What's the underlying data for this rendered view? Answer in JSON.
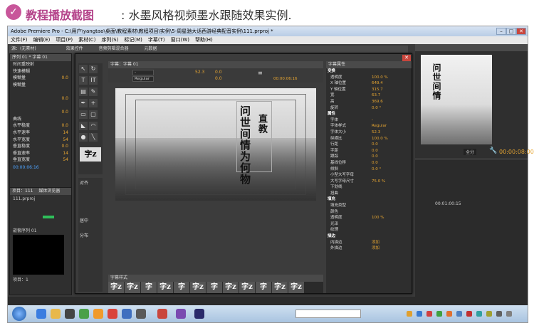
{
  "banner": {
    "icon": "chevron-down-icon",
    "title": "教程播放截图",
    "subtitle": ": 水墨风格视频墨水跟随效果实例."
  },
  "window": {
    "title": "Adobe Premiere Pro - C:\\用户\\yangtao\\桌面\\教程素材\\教程项目\\实例\\5-周星驰大话西游经典配音实例\\111.prproj *",
    "minimize": "–",
    "maximize": "□",
    "close": "✕"
  },
  "menu": [
    "文件(F)",
    "编辑(E)",
    "项目(P)",
    "素材(C)",
    "序列(S)",
    "标记(M)",
    "字幕(T)",
    "窗口(W)",
    "帮助(H)"
  ],
  "top_tabs": {
    "source": "源：(无素材)",
    "effect_controls": "效果控件",
    "audio_mixer": "音频剪辑混合器",
    "metadata": "元数据"
  },
  "left_panel": {
    "tab": "序列 01 * 字幕 01",
    "rows": [
      {
        "label": "时间重映射",
        "value": ""
      },
      {
        "label": "快速模糊",
        "value": ""
      },
      {
        "label": "模糊量",
        "value": "0.0"
      },
      {
        "label": "模糊量",
        "value": ""
      },
      {
        "label": "",
        "value": ""
      },
      {
        "label": "",
        "value": "0.0"
      },
      {
        "label": "",
        "value": ""
      },
      {
        "label": "",
        "value": "0.0"
      },
      {
        "label": "曲线",
        "value": ""
      },
      {
        "label": "水平稳度",
        "value": "0.0"
      },
      {
        "label": "水平速率",
        "value": "14"
      },
      {
        "label": "水平宽度",
        "value": "54"
      },
      {
        "label": "垂直稳度",
        "value": "0.0"
      },
      {
        "label": "垂直速率",
        "value": "14"
      },
      {
        "label": "垂直宽度",
        "value": "54"
      }
    ],
    "timecode": "00:00:06:16"
  },
  "project_panel": {
    "tab": "项目：111",
    "tab2": "媒体浏览器",
    "file": "111.prproj",
    "seq_label": "嵌套序列 01",
    "bottom_label": "项目：1"
  },
  "dialog": {
    "close": "✕",
    "editor_tab": "字幕：字幕 01",
    "font_style": "Regular",
    "font_size": "52.3",
    "kerning": "0.0",
    "leading": "0.0",
    "timecode": "00:00:06:16",
    "callig_main": "问世间情为何物",
    "callig_small": "直教",
    "tools_label": "字z",
    "align_label": "对齐",
    "center_label": "居中",
    "distribute_label": "分布",
    "styles_tab": "字幕样式",
    "styles": [
      "字z",
      "字z",
      "字",
      "字z",
      "字",
      "字z",
      "字",
      "字z",
      "字z",
      "字",
      "字z",
      "字z"
    ],
    "properties_tab": "字幕属性",
    "properties": [
      {
        "label": "变换",
        "value": "",
        "section": true
      },
      {
        "label": "透明度",
        "value": "100.0 %"
      },
      {
        "label": "X 轴位置",
        "value": "649.4"
      },
      {
        "label": "Y 轴位置",
        "value": "315.7"
      },
      {
        "label": "宽",
        "value": "63.7"
      },
      {
        "label": "高",
        "value": "369.6"
      },
      {
        "label": "旋转",
        "value": "0.0 °"
      },
      {
        "label": "属性",
        "value": "",
        "section": true
      },
      {
        "label": "字体",
        "value": "-"
      },
      {
        "label": "字体样式",
        "value": "Regular"
      },
      {
        "label": "字体大小",
        "value": "52.3"
      },
      {
        "label": "纵横比",
        "value": "100.0 %"
      },
      {
        "label": "行距",
        "value": "0.0"
      },
      {
        "label": "字距",
        "value": "0.0"
      },
      {
        "label": "跟踪",
        "value": "0.0"
      },
      {
        "label": "基线位移",
        "value": "0.0"
      },
      {
        "label": "倾斜",
        "value": "0.0 °"
      },
      {
        "label": "小型大写字母",
        "value": ""
      },
      {
        "label": "大写字母尺寸",
        "value": "75.0 %"
      },
      {
        "label": "下划线",
        "value": ""
      },
      {
        "label": "扭曲",
        "value": ""
      },
      {
        "label": "填充",
        "value": "",
        "section": true
      },
      {
        "label": "填充类型",
        "value": ""
      },
      {
        "label": "颜色",
        "value": ""
      },
      {
        "label": "透明度",
        "value": "100 %"
      },
      {
        "label": "光泽",
        "value": ""
      },
      {
        "label": "纹理",
        "value": ""
      },
      {
        "label": "描边",
        "value": "",
        "section": true
      },
      {
        "label": "内描边",
        "value": "添加"
      },
      {
        "label": "外描边",
        "value": "添加"
      }
    ]
  },
  "program_monitor": {
    "timecode": "00:00:08:00",
    "zoom": "全分",
    "callig": "问世间情",
    "timeline_time": "00:01:00:15"
  },
  "colors": {
    "accent": "#e6a531",
    "banner": "#b4438a",
    "panel": "#2f2f2f"
  }
}
